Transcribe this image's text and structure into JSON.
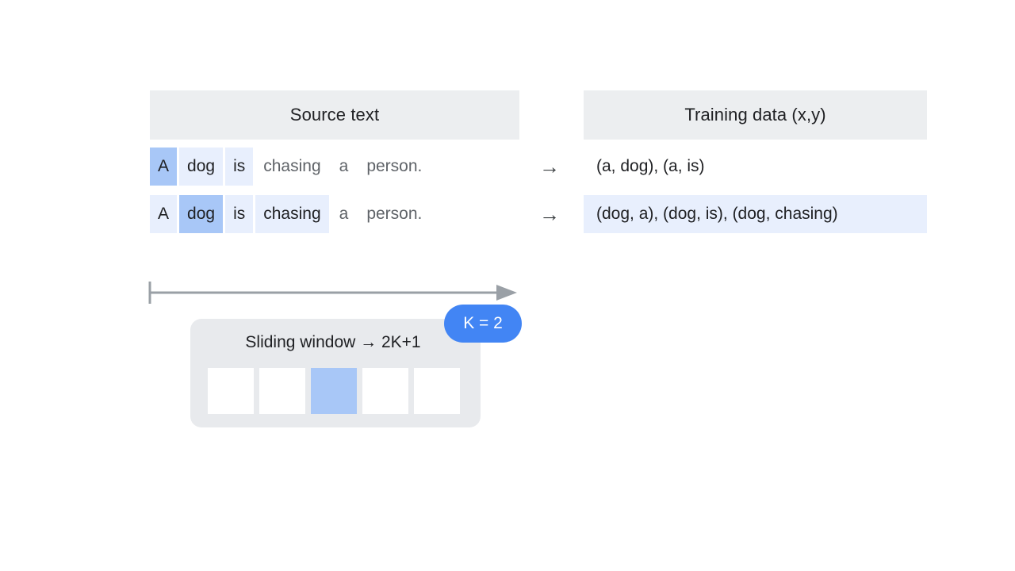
{
  "headers": {
    "source": "Source text",
    "training": "Training data (x,y)"
  },
  "arrow_glyph": "→",
  "source_rows": [
    {
      "tokens": [
        {
          "text": "A",
          "highlight": "strong"
        },
        {
          "text": "dog",
          "highlight": "weak"
        },
        {
          "text": "is",
          "highlight": "weak"
        },
        {
          "text": "chasing",
          "highlight": "none"
        },
        {
          "text": "a",
          "highlight": "none"
        },
        {
          "text": "person.",
          "highlight": "none"
        }
      ]
    },
    {
      "tokens": [
        {
          "text": "A",
          "highlight": "weak"
        },
        {
          "text": "dog",
          "highlight": "strong"
        },
        {
          "text": "is",
          "highlight": "weak"
        },
        {
          "text": "chasing",
          "highlight": "weak"
        },
        {
          "text": "a",
          "highlight": "none"
        },
        {
          "text": "person.",
          "highlight": "none"
        }
      ]
    }
  ],
  "training_rows": [
    {
      "text": "(a, dog), (a, is)",
      "highlighted": false
    },
    {
      "text": "(dog, a), (dog, is), (dog, chasing)",
      "highlighted": true
    }
  ],
  "window": {
    "title": "Sliding window → 2K+1",
    "cells": [
      {
        "active": false
      },
      {
        "active": false
      },
      {
        "active": true
      },
      {
        "active": false
      },
      {
        "active": false
      }
    ],
    "badge_label": "K = 2"
  },
  "colors": {
    "highlight_strong": "#a8c7f7",
    "highlight_weak": "#e8effd",
    "header_gray": "#eceef0",
    "card_gray": "#e8eaed",
    "badge_blue": "#4285f4",
    "timeline_gray": "#9aa0a6",
    "text_primary": "#202124",
    "text_muted": "#5f6368"
  }
}
